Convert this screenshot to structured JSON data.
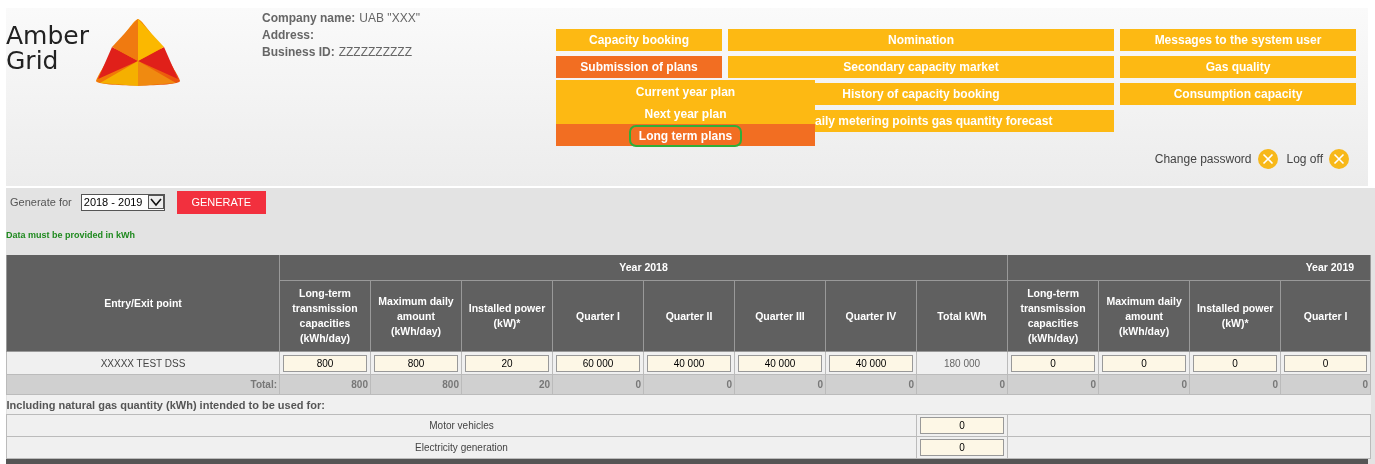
{
  "logo": {
    "line1": "Amber",
    "line2": "Grid"
  },
  "company": [
    {
      "label": "Company name:",
      "value": "UAB \"XXX\""
    },
    {
      "label": "Address:"
    },
    {
      "label": "Business ID:",
      "value": "ZZZZZZZZZZ"
    }
  ],
  "menu": [
    [
      {
        "label": "Capacity booking",
        "selected": false
      },
      {
        "label": "Submission of plans",
        "selected": true
      }
    ],
    [
      {
        "label": "Nomination",
        "selected": false
      },
      {
        "label": "Secondary capacity market",
        "selected": false
      },
      {
        "label": "History of capacity booking",
        "selected": false
      },
      {
        "label": "aily metering points gas quantity forecast",
        "selected": false
      }
    ],
    [
      {
        "label": "Messages to the system user",
        "selected": false
      },
      {
        "label": "Gas quality",
        "selected": false
      },
      {
        "label": "Consumption capacity",
        "selected": false
      }
    ]
  ],
  "submenu": [
    {
      "label": "Current year plan",
      "selected": false,
      "circled": false
    },
    {
      "label": "Next year plan",
      "selected": false,
      "circled": false
    },
    {
      "label": "Long term plans",
      "selected": true,
      "circled": true
    }
  ],
  "account": {
    "change_password": "Change password",
    "log_off": "Log off"
  },
  "generate": {
    "label": "Generate for",
    "period": "2018 - 2019",
    "button": "GENERATE"
  },
  "note": "Data must be provided in kWh",
  "table": {
    "entry_header": "Entry/Exit point",
    "years": [
      {
        "label": "Year 2018",
        "columns": [
          "Long-term transmission capacities (kWh/day)",
          "Maximum daily amount (kWh/day)",
          "Installed power (kW)*",
          "Quarter I",
          "Quarter II",
          "Quarter III",
          "Quarter IV",
          "Total kWh"
        ]
      },
      {
        "label": "Year 2019",
        "columns": [
          "Long-term transmission capacities (kWh/day)",
          "Maximum daily amount (kWh/day)",
          "Installed power (kW)*",
          "Quarter I"
        ]
      }
    ],
    "rows": [
      {
        "name": "XXXXX TEST DSS",
        "cells": [
          {
            "kind": "input",
            "value": "800"
          },
          {
            "kind": "input",
            "value": "800"
          },
          {
            "kind": "input",
            "value": "20"
          },
          {
            "kind": "input",
            "value": "60 000"
          },
          {
            "kind": "input",
            "value": "40 000"
          },
          {
            "kind": "input",
            "value": "40 000"
          },
          {
            "kind": "input",
            "value": "40 000"
          },
          {
            "kind": "text",
            "value": "180 000"
          },
          {
            "kind": "input",
            "value": "0"
          },
          {
            "kind": "input",
            "value": "0"
          },
          {
            "kind": "input",
            "value": "0"
          },
          {
            "kind": "input",
            "value": "0"
          }
        ]
      }
    ],
    "total": {
      "label": "Total:",
      "values": [
        "800",
        "800",
        "20",
        "0",
        "0",
        "0",
        "0",
        "0",
        "0",
        "0",
        "0",
        "0"
      ]
    }
  },
  "usage": {
    "title": "Including natural gas quantity (kWh) intended to be used for:",
    "rows": [
      {
        "label": "Motor vehicles",
        "value": "0"
      },
      {
        "label": "Electricity generation",
        "value": "0"
      }
    ]
  }
}
